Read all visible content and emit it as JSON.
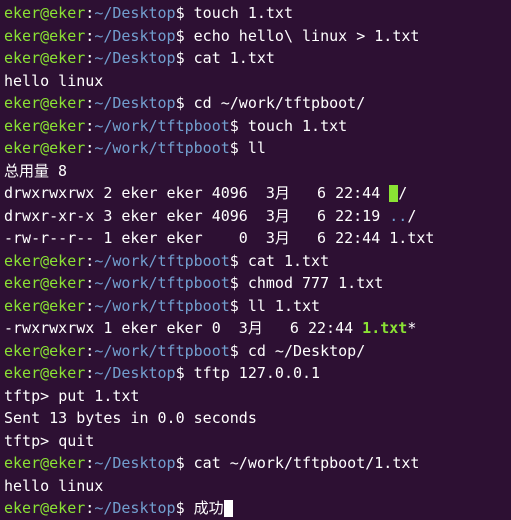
{
  "prompt": {
    "user": "eker",
    "at": "@",
    "host": "eker",
    "colon": ":",
    "desktop_path": "~/Desktop",
    "tftp_path": "~/work/tftpboot",
    "dollar": "$ "
  },
  "lines": {
    "l0_cmd": "touch 1.txt",
    "l1_cmd": "echo hello\\ linux > 1.txt",
    "l2_cmd": "cat 1.txt",
    "l3_out": "hello linux",
    "l4_cmd": "cd ~/work/tftpboot/",
    "l5_cmd": "touch 1.txt",
    "l6_cmd": "ll",
    "l7_out": "总用量 8",
    "l8_perm": "drwxrwxrwx 2 eker eker 4096  3月   6 22:44 ",
    "l8_dir": ".",
    "l8_slash": "/",
    "l9_perm": "drwxr-xr-x 3 eker eker 4096  3月   6 22:19 ",
    "l9_dir": "..",
    "l9_slash": "/",
    "l10_out": "-rw-r--r-- 1 eker eker    0  3月   6 22:44 1.txt",
    "l11_cmd": "cat 1.txt",
    "l12_cmd": "chmod 777 1.txt",
    "l13_cmd": "ll 1.txt",
    "l14_perm": "-rwxrwxrwx 1 eker eker 0  3月   6 22:44 ",
    "l14_file": "1.txt",
    "l14_star": "*",
    "l15_cmd": "cd ~/Desktop/",
    "l16_cmd": "tftp 127.0.0.1",
    "l17_prompt": "tftp> ",
    "l17_cmd": "put 1.txt",
    "l18_out": "Sent 13 bytes in 0.0 seconds",
    "l19_prompt": "tftp> ",
    "l19_cmd": "quit",
    "l20_cmd": "cat ~/work/tftpboot/1.txt",
    "l21_out": "hello linux",
    "l22_cmd": "成功"
  }
}
